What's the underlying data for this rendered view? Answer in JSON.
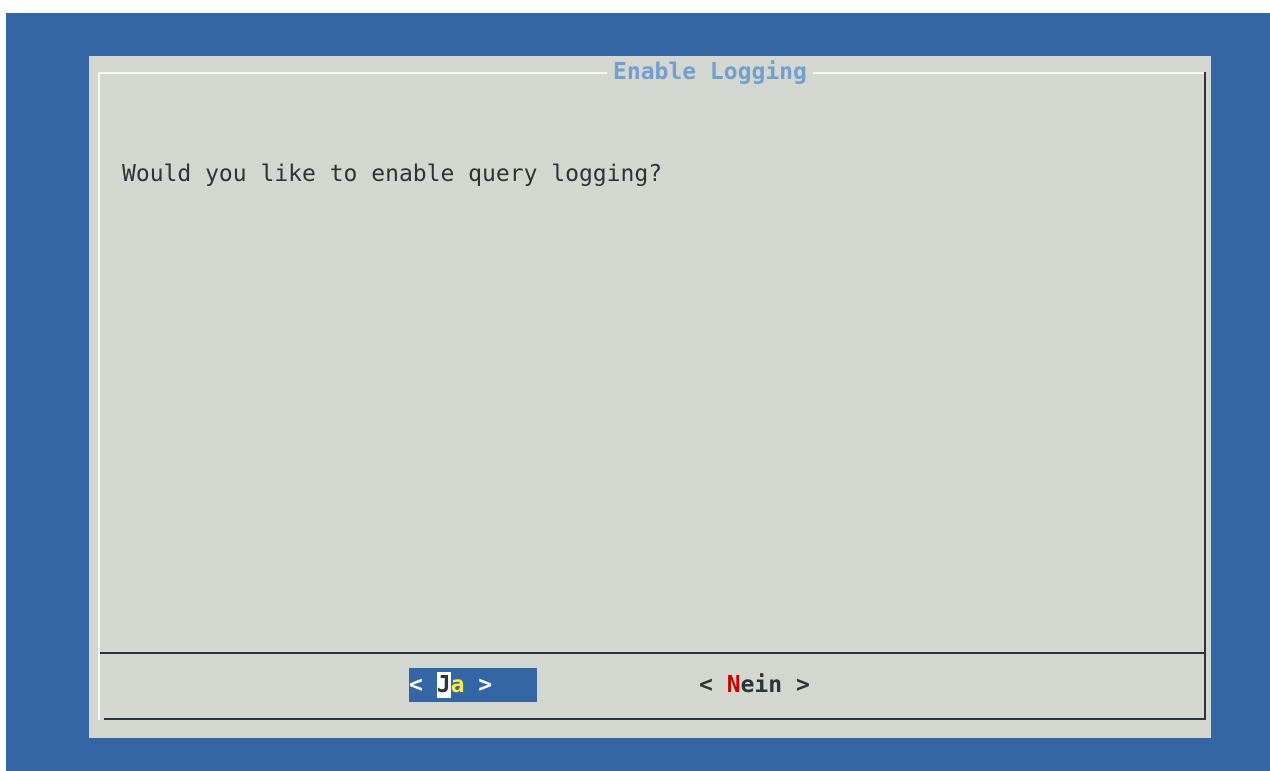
{
  "dialog": {
    "title": "Enable Logging",
    "message": "Would you like to enable query logging?"
  },
  "buttons": {
    "yes": {
      "open": "< ",
      "hotkey": "J",
      "rest": "a",
      "close": " >",
      "selected": true
    },
    "no": {
      "open": "< ",
      "hotkey": "N",
      "rest": "ein",
      "close": " >",
      "selected": false
    }
  },
  "colors": {
    "background": "#3465a4",
    "dialog": "#d3d7cf",
    "title": "#729fcf",
    "hotkey_no": "#cc0000",
    "hotkey_yes": "#fce94f"
  }
}
